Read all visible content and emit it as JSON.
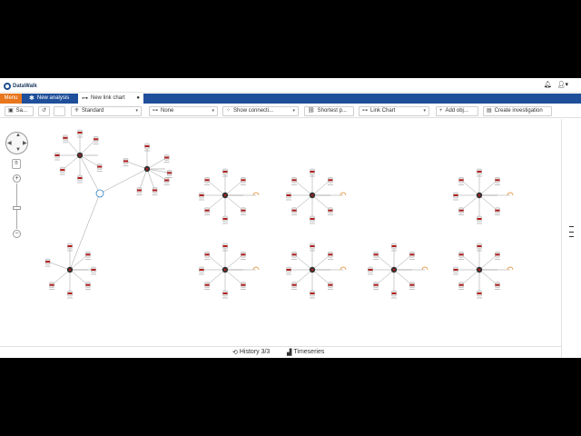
{
  "app": {
    "logo_text": "DataWalk"
  },
  "header": {
    "bell_icon": "bell-icon",
    "user_icon": "user-icon",
    "user_caret": "▾"
  },
  "tabs": {
    "menu_label": "Menu",
    "analysis_label": "New analysis",
    "linkchart_label": "New link chart"
  },
  "toolbar": {
    "save_label": "Sa...",
    "layout_select": "Standard",
    "group_select": "None",
    "connections_select": "Show connecti...",
    "shortest_path_label": "Shortest p...",
    "chart_type_select": "Link Chart",
    "add_objects_label": "Add obj...",
    "create_investigation_label": "Create investigation"
  },
  "bottom": {
    "history_label": "History 3/3",
    "timeseries_label": "Timeseries"
  },
  "accent": {
    "brand_blue": "#1f4f9a",
    "menu_orange": "#e8761c",
    "node_red": "#b01e1e"
  }
}
